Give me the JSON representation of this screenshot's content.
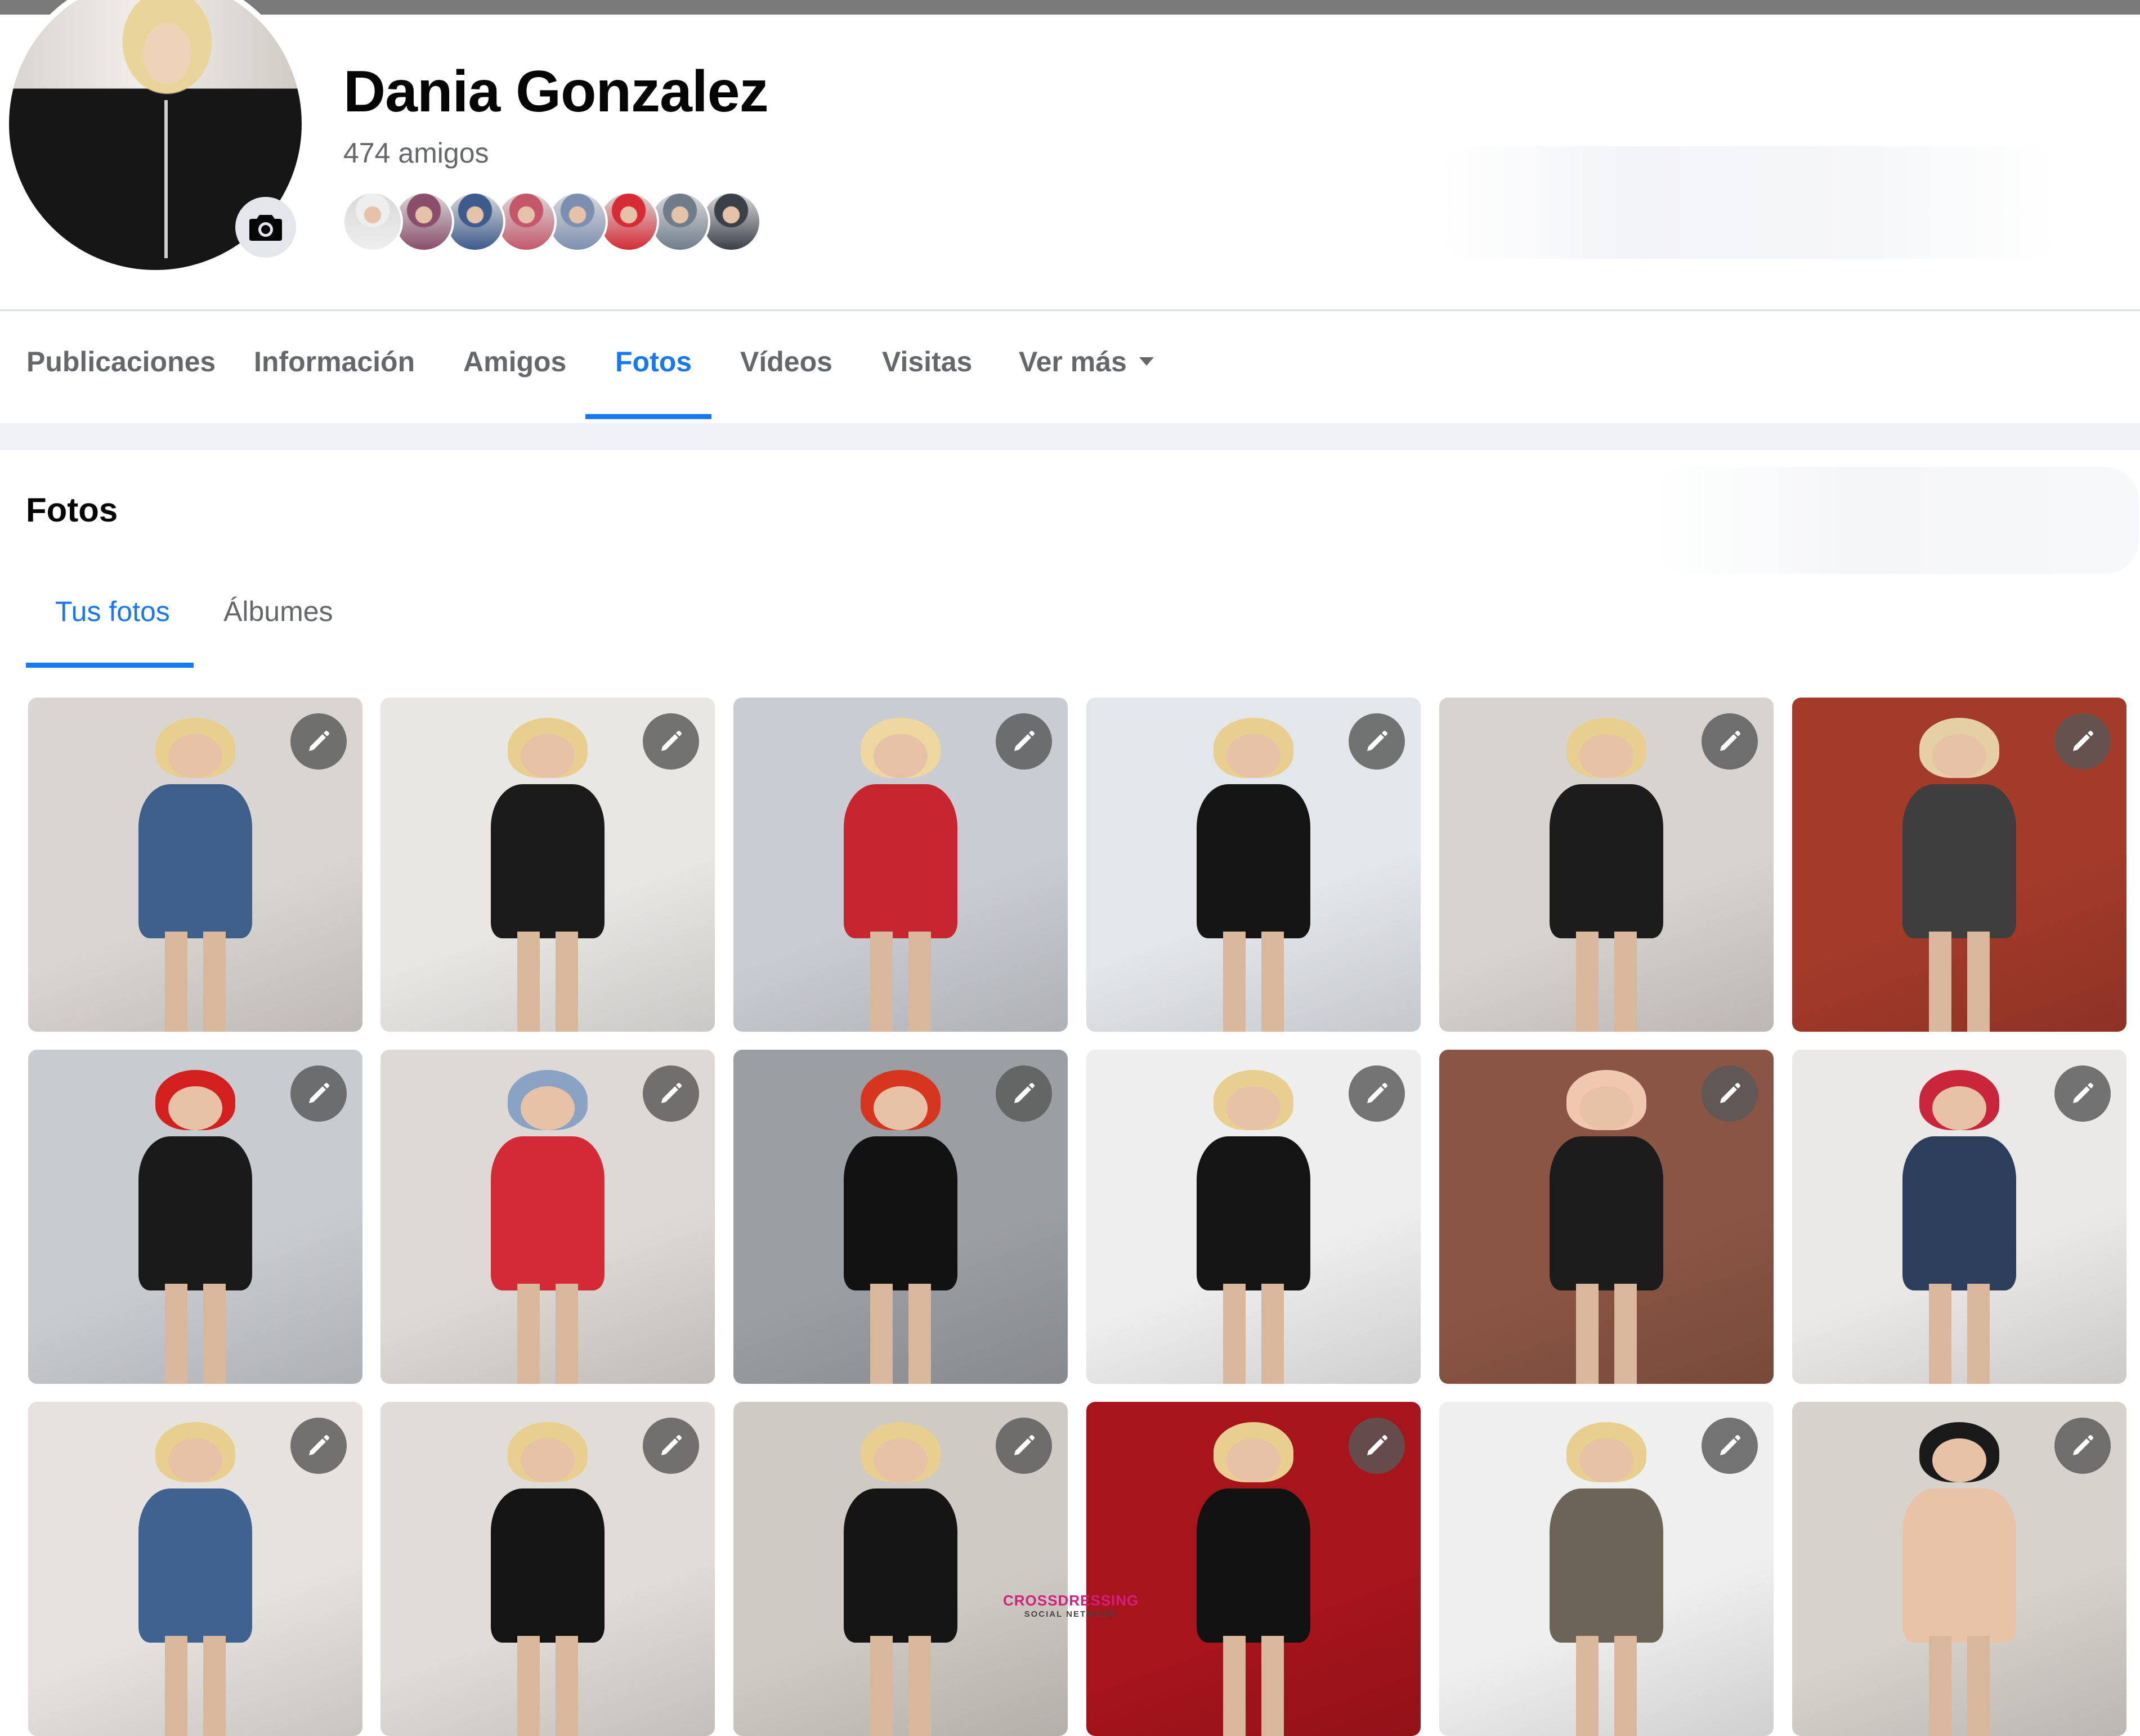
{
  "profile": {
    "name": "Dania Gonzalez",
    "friends_count": "474 amigos",
    "friend_avatar_colors": [
      "#eeeeee",
      "#8a4e6b",
      "#3d5b8c",
      "#c4586b",
      "#7d8fb0",
      "#d62a35",
      "#6f7d8b",
      "#3a3f48"
    ]
  },
  "nav": {
    "tabs": [
      {
        "label": "Publicaciones"
      },
      {
        "label": "Información"
      },
      {
        "label": "Amigos"
      },
      {
        "label": "Fotos",
        "active": true
      },
      {
        "label": "Vídeos"
      },
      {
        "label": "Visitas"
      },
      {
        "label": "Ver más"
      }
    ]
  },
  "photos_section": {
    "title": "Fotos",
    "subtabs": [
      {
        "label": "Tus fotos",
        "active": true
      },
      {
        "label": "Álbumes"
      }
    ]
  },
  "photo_grid": {
    "edit_icon": "pencil-icon",
    "tiles": [
      {
        "bg": "#d9d6d2",
        "hair": "#e8cf8f",
        "outfit": "#3d5f8a"
      },
      {
        "bg": "#e9e7e4",
        "hair": "#e8cf8f",
        "outfit": "#1b1b1b"
      },
      {
        "bg": "#c9ccd2",
        "hair": "#eed7a0",
        "outfit": "#c8262e"
      },
      {
        "bg": "#e3e6ea",
        "hair": "#e8cf8f",
        "outfit": "#151515"
      },
      {
        "bg": "#d7d3cf",
        "hair": "#e8cf8f",
        "outfit": "#1c1c1c"
      },
      {
        "bg": "#a33a2a",
        "hair": "#e4d0a4",
        "outfit": "#3e3e3e"
      },
      {
        "bg": "#c8cbd0",
        "hair": "#d41f1f",
        "outfit": "#1a1a1a"
      },
      {
        "bg": "#ddd9d4",
        "hair": "#8aa3c4",
        "outfit": "#d42a35"
      },
      {
        "bg": "#9b9ea3",
        "hair": "#d6351e",
        "outfit": "#121212"
      },
      {
        "bg": "#eeeeee",
        "hair": "#e8cf8f",
        "outfit": "#141414"
      },
      {
        "bg": "#8a5544",
        "hair": "#f0c8b0",
        "outfit": "#1c1c1c"
      },
      {
        "bg": "#ebe9e7",
        "hair": "#c9263b",
        "outfit": "#2c3e5c"
      },
      {
        "bg": "#e6e3df",
        "hair": "#e8cf8f",
        "outfit": "#3f6291"
      },
      {
        "bg": "#e0ddd8",
        "hair": "#e8cf8f",
        "outfit": "#141414"
      },
      {
        "bg": "#cfcac3",
        "hair": "#e8cf8f",
        "outfit": "#151515"
      },
      {
        "bg": "#a8141c",
        "hair": "#e8cf8f",
        "outfit": "#121212"
      },
      {
        "bg": "#efefef",
        "hair": "#e8cf8f",
        "outfit": "#6d6458"
      },
      {
        "bg": "#d7d2cc",
        "hair": "#1a1a1a",
        "outfit": "#e8c3a8"
      }
    ]
  },
  "watermark": {
    "line1": "CROSSDRESSING",
    "line2": "SOCIAL NETWORK"
  }
}
